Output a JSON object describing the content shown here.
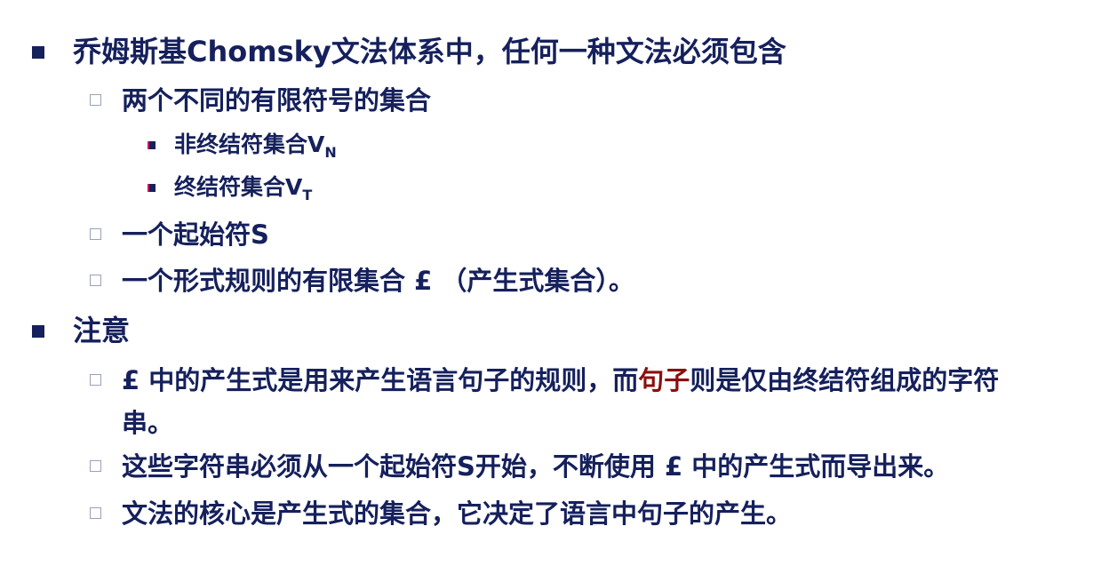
{
  "items": [
    {
      "text": "乔姆斯基Chomsky文法体系中，任何一种文法必须包含"
    },
    {
      "text": "两个不同的有限符号的集合"
    },
    {
      "text": "非终结符集合V",
      "sub": "N"
    },
    {
      "text": "终结符集合V",
      "sub": "T"
    },
    {
      "text": "一个起始符S"
    },
    {
      "text": "一个形式规则的有限集合 £ （产生式集合）。"
    },
    {
      "text": "注意"
    },
    {
      "pre": " £ 中的产生式是用来产生语言句子的规则，而",
      "red": "句子",
      "post": "则是仅由终结符组成的字符串。"
    },
    {
      "text": "这些字符串必须从一个起始符S开始，不断使用 £ 中的产生式而导出来。"
    },
    {
      "text": "文法的核心是产生式的集合，它决定了语言中句子的产生。"
    }
  ],
  "colors": {
    "text": "#15205c",
    "highlight": "#8b0f0f",
    "hollow_bullet": "#9aa0b8"
  }
}
